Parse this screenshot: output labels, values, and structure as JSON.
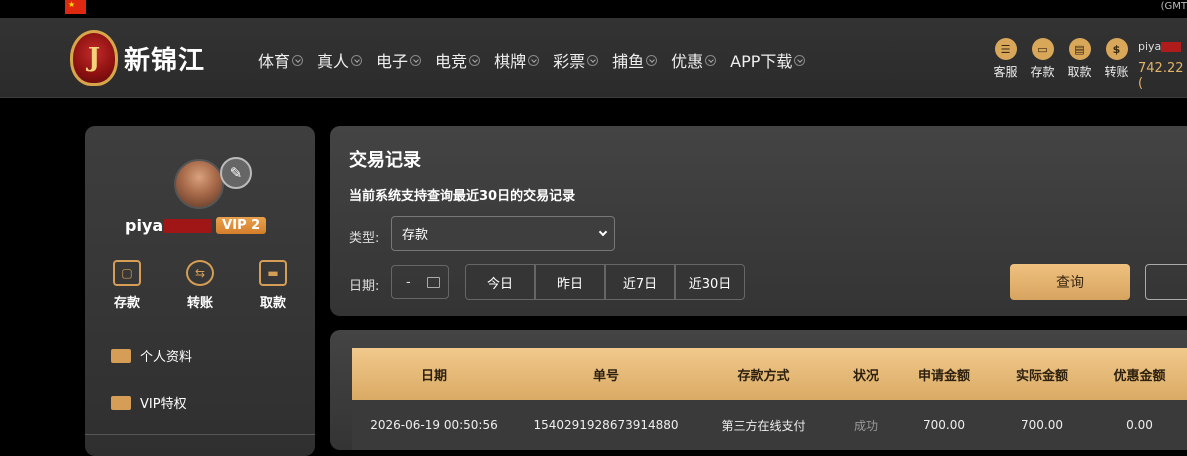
{
  "top": {
    "timezone": "(GMT"
  },
  "brand": {
    "name": "新锦江",
    "badge_letter": "J"
  },
  "nav": [
    "体育",
    "真人",
    "电子",
    "电竞",
    "棋牌",
    "彩票",
    "捕鱼",
    "优惠",
    "APP下载"
  ],
  "quick_actions": [
    {
      "label": "客服",
      "icon": "chat-icon"
    },
    {
      "label": "存款",
      "icon": "wallet-icon"
    },
    {
      "label": "取款",
      "icon": "withdraw-icon"
    },
    {
      "label": "转账",
      "icon": "transfer-icon"
    }
  ],
  "user": {
    "name_prefix": "piya",
    "balance": "742.22 (",
    "vip": "VIP 2"
  },
  "sidebar": {
    "actions": [
      {
        "label": "存款",
        "icon": "wallet-icon"
      },
      {
        "label": "转账",
        "icon": "transfer-icon"
      },
      {
        "label": "取款",
        "icon": "card-icon"
      }
    ],
    "links": [
      "个人资料",
      "VIP特权"
    ]
  },
  "panel": {
    "title": "交易记录",
    "subtitle": "当前系统支持查询最近30日的交易记录",
    "type_label": "类型:",
    "type_value": "存款",
    "date_label": "日期:",
    "date_value": "-",
    "quick_ranges": [
      "今日",
      "昨日",
      "近7日",
      "近30日"
    ],
    "search_label": "查询"
  },
  "table": {
    "headers": [
      "日期",
      "单号",
      "存款方式",
      "状况",
      "申请金额",
      "实际金额",
      "优惠金额"
    ],
    "rows": [
      [
        "2026-06-19 00:50:56",
        "1540291928673914880",
        "第三方在线支付",
        "成功",
        "700.00",
        "700.00",
        "0.00"
      ]
    ]
  },
  "colors": {
    "accent": "#d9aa64",
    "background": "#000000",
    "panel": "#3a3a3a"
  }
}
